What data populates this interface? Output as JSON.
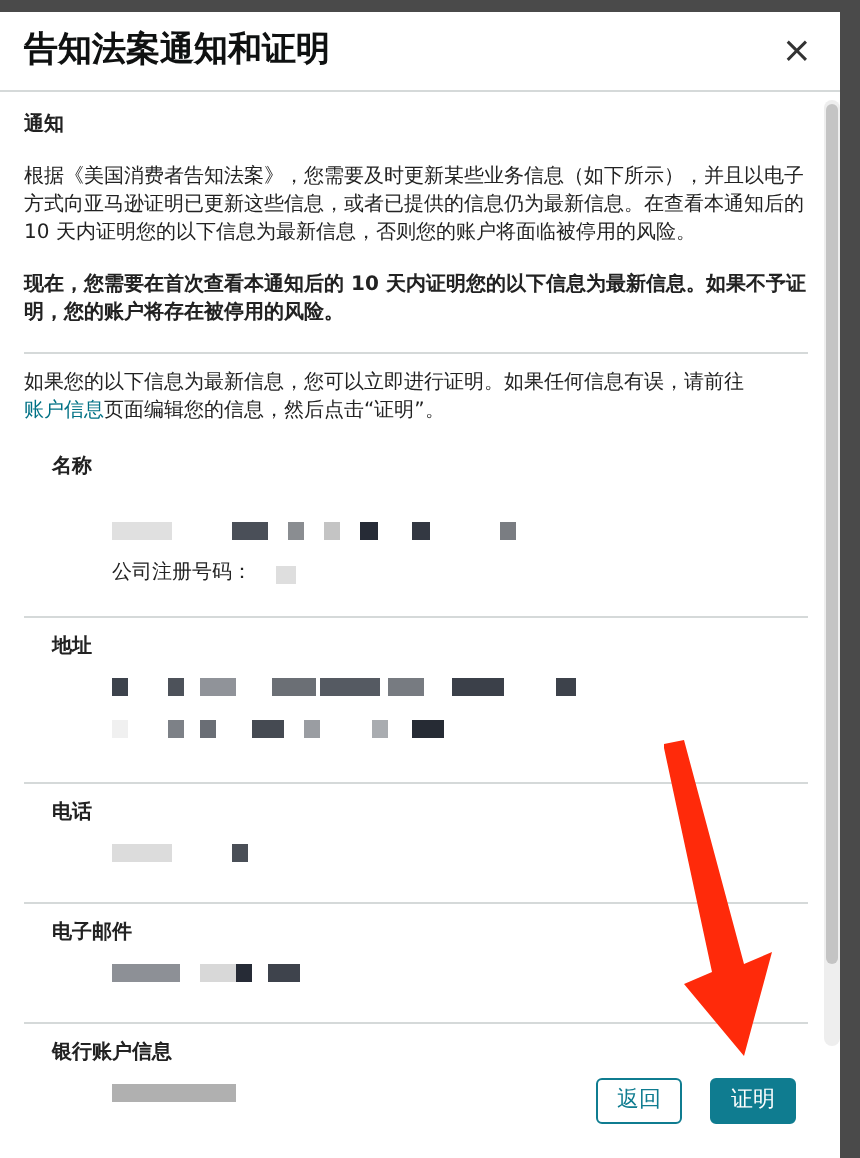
{
  "dialog": {
    "title": "告知法案通知和证明",
    "close": "×"
  },
  "notice": {
    "heading": "通知",
    "paragraphs": [
      {
        "text": "根据《美国消费者告知法案》，您需要及时更新某些业务信息（如下所示），并且以电子方式向亚马逊证明已更新这些信息，或者已提供的信息仍为最新信息。在查看本通知后的 10 天内证明您的以下信息为最新信息，否则您的账户将面临被停用的风险。",
        "bold": false
      },
      {
        "text": "现在，您需要在首次查看本通知后的 10 天内证明您的以下信息为最新信息。如果不予证明，您的账户将存在被停用的风险。",
        "bold": true
      }
    ]
  },
  "instruction": {
    "before": "如果您的以下信息为最新信息，您可以立即进行证明。如果任何信息有误，请前往",
    "link": "账户信息",
    "after": "页面编辑您的信息，然后点击“证明”。"
  },
  "sections": [
    {
      "label": "名称",
      "fields": [
        "公司注册号码："
      ]
    },
    {
      "label": "地址"
    },
    {
      "label": "电话"
    },
    {
      "label": "电子邮件"
    },
    {
      "label": "银行账户信息"
    }
  ],
  "buttons": [
    {
      "label": "返回",
      "kind": "secondary"
    },
    {
      "label": "证明",
      "kind": "primary"
    }
  ]
}
